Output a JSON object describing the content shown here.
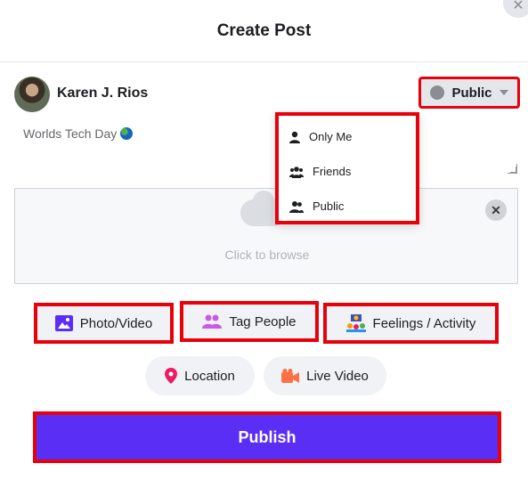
{
  "header": {
    "title": "Create Post"
  },
  "user": {
    "name": "Karen J. Rios"
  },
  "privacy": {
    "selected": "Public"
  },
  "post": {
    "text": "Worlds Tech Day"
  },
  "dropzone": {
    "hint": "Click to browse"
  },
  "privacy_menu": {
    "items": [
      "Only Me",
      "Friends",
      "Public"
    ]
  },
  "actions": {
    "photo_video": "Photo/Video",
    "tag_people": "Tag People",
    "feelings": "Feelings / Activity",
    "location": "Location",
    "live_video": "Live Video"
  },
  "publish": {
    "label": "Publish"
  },
  "colors": {
    "accent": "#5b2ef5",
    "highlight": "#e8000b",
    "photo": "#5b2ef5",
    "tag": "#c85ae8",
    "location": "#e91e63",
    "live": "#ff7043"
  }
}
